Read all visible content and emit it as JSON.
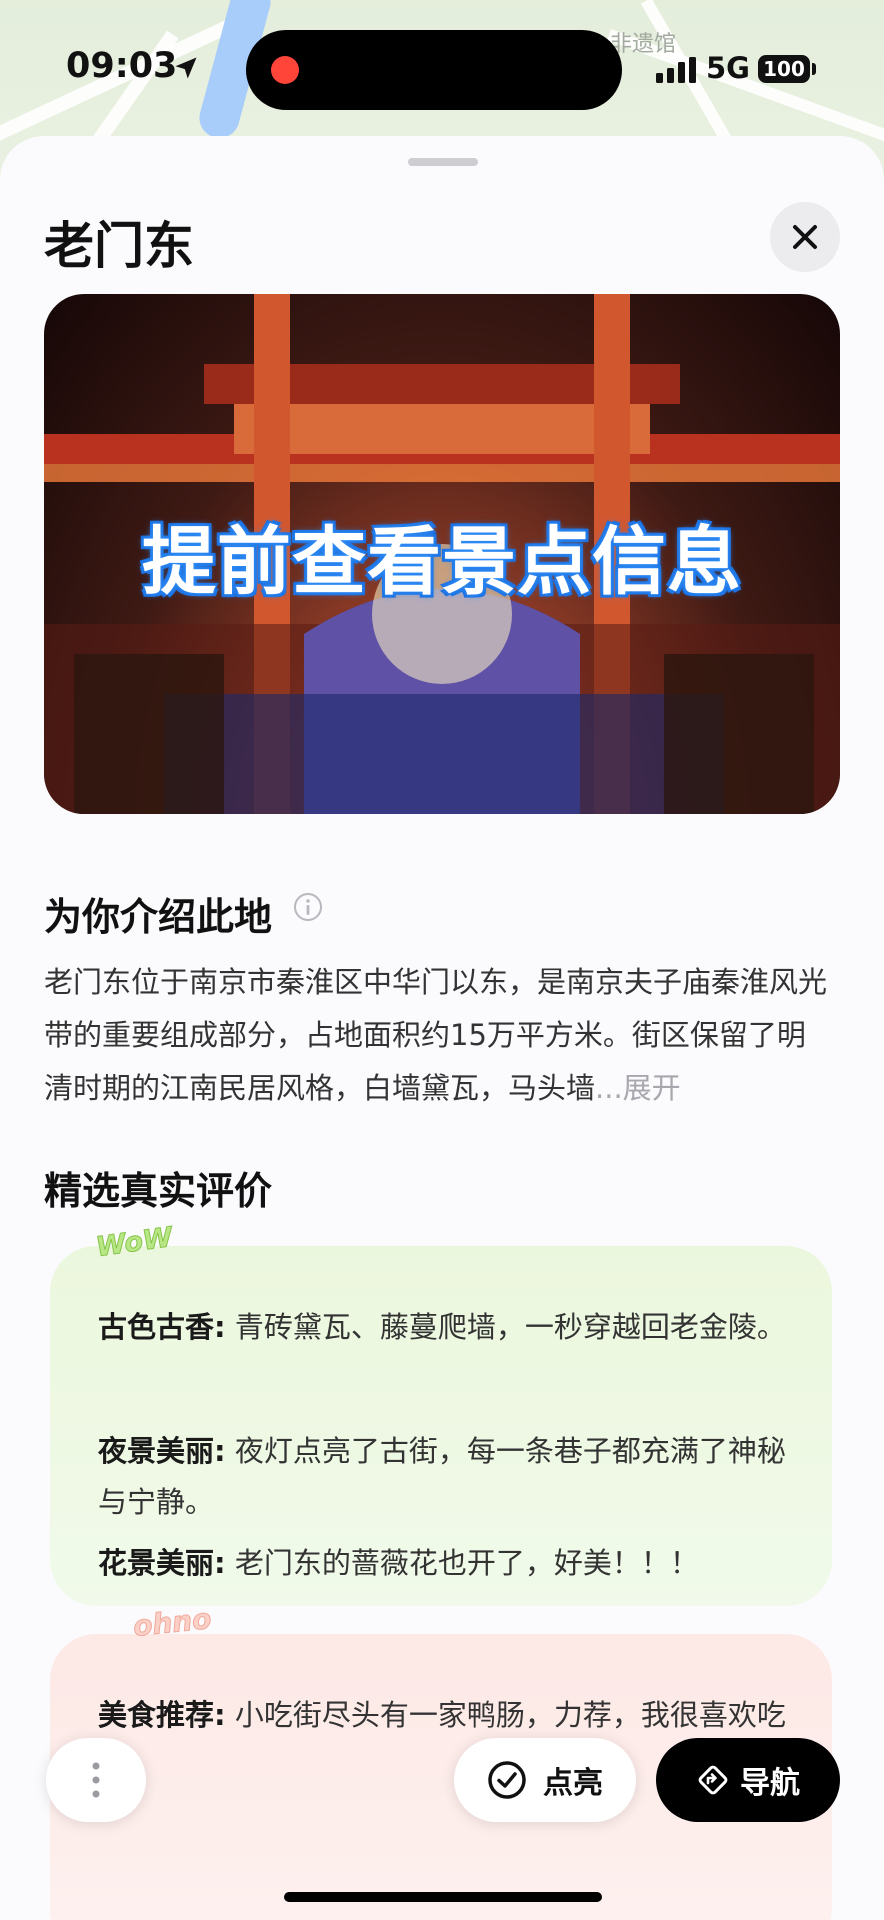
{
  "status_bar": {
    "time": "09:03",
    "network": "5G",
    "battery": "100"
  },
  "map": {
    "poi_label": "· 非遗馆"
  },
  "place": {
    "title": "老门东",
    "hero_caption": "提前查看景点信息"
  },
  "intro": {
    "heading": "为你介绍此地",
    "text": "老门东位于南京市秦淮区中华门以东，是南京夫子庙秦淮风光带的重要组成部分，占地面积约15万平方米。街区保留了明清时期的江南民居风格，白墙黛瓦，马头墙",
    "ellipsis": "...",
    "expand_label": "展开"
  },
  "reviews": {
    "heading": "精选真实评价",
    "positive_sticker": "WoW",
    "negative_sticker": "ohno",
    "positive": [
      {
        "tag": "古色古香:",
        "text": " 青砖黛瓦、藤蔓爬墙，一秒穿越回老金陵。"
      },
      {
        "tag": "夜景美丽:",
        "text": " 夜灯点亮了古街，每一条巷子都充满了神秘与宁静。"
      },
      {
        "tag": "花景美丽:",
        "text": " 老门东的蔷薇花也开了，好美！！！"
      }
    ],
    "negative": [
      {
        "tag": "美食推荐:",
        "text": " 小吃街尽头有一家鸭肠，力荐，我很喜欢吃~"
      }
    ]
  },
  "actions": {
    "light_label": "点亮",
    "nav_label": "导航"
  },
  "colors": {
    "accent": "#000000",
    "positive_card": "#ebf7dd",
    "negative_card": "#fde9e6",
    "record_dot": "#ff453a"
  }
}
